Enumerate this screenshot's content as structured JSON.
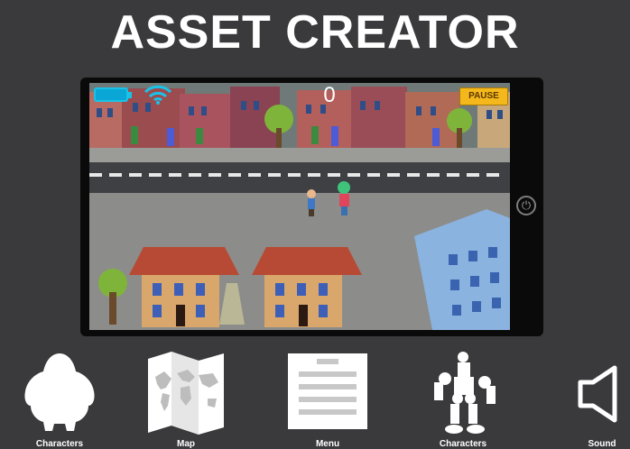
{
  "title": "ASSET CREATOR",
  "game": {
    "score": "0",
    "pause_label": "PAUSE"
  },
  "toolbar": [
    {
      "label": "Characters",
      "icon": "monster-icon"
    },
    {
      "label": "Map",
      "icon": "world-map-icon"
    },
    {
      "label": "Menu",
      "icon": "menu-icon"
    },
    {
      "label": "Characters",
      "icon": "robot-icon"
    },
    {
      "label": "Sound",
      "icon": "speaker-icon"
    }
  ],
  "colors": {
    "background": "#3a3a3c",
    "accent_cyan": "#19c3e8",
    "pause_button": "#f5b81c"
  }
}
